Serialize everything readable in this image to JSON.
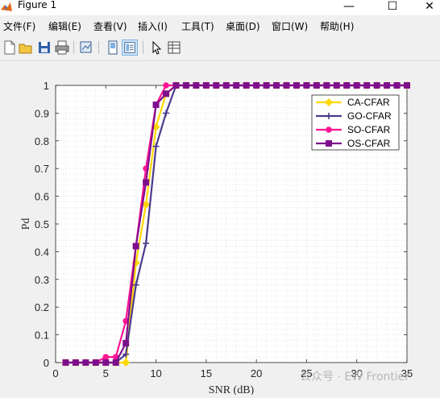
{
  "window": {
    "title": "Figure 1",
    "minimize": "—",
    "maximize": "☐",
    "close": "✕"
  },
  "menu": [
    {
      "label": "文件(F)"
    },
    {
      "label": "编辑(E)"
    },
    {
      "label": "查看(V)"
    },
    {
      "label": "插入(I)"
    },
    {
      "label": "工具(T)"
    },
    {
      "label": "桌面(D)"
    },
    {
      "label": "窗口(W)"
    },
    {
      "label": "帮助(H)"
    }
  ],
  "toolbar": [
    "new-figure-icon",
    "open-icon",
    "save-icon",
    "print-icon",
    "link-plot-icon",
    "hide-plot-tools-icon",
    "show-plot-tools-icon",
    "select-arrow-icon",
    "property-inspector-icon"
  ],
  "watermark": "公众号 · EW Frontier",
  "chart_data": {
    "type": "line",
    "xlabel": "SNR (dB)",
    "ylabel": "Pd",
    "xlim": [
      0,
      35
    ],
    "ylim": [
      0,
      1
    ],
    "xticks": [
      "0",
      "5",
      "10",
      "15",
      "20",
      "25",
      "30",
      "35"
    ],
    "yticks": [
      "0",
      "0.1",
      "0.2",
      "0.3",
      "0.4",
      "0.5",
      "0.6",
      "0.7",
      "0.8",
      "0.9",
      "1"
    ],
    "grid": "minor dotted",
    "legend_position": "top-right",
    "x": [
      1,
      2,
      3,
      4,
      5,
      6,
      7,
      8,
      9,
      10,
      11,
      12,
      13,
      14,
      15,
      16,
      17,
      18,
      19,
      20,
      21,
      22,
      23,
      24,
      25,
      26,
      27,
      28,
      29,
      30,
      31,
      32,
      33,
      34,
      35
    ],
    "series": [
      {
        "name": "CA-CFAR",
        "color": "#ffd700",
        "marker": "diamond",
        "values": [
          0,
          0,
          0,
          0,
          0,
          0,
          0,
          0.36,
          0.57,
          0.85,
          0.97,
          1,
          1,
          1,
          1,
          1,
          1,
          1,
          1,
          1,
          1,
          1,
          1,
          1,
          1,
          1,
          1,
          1,
          1,
          1,
          1,
          1,
          1,
          1,
          1
        ]
      },
      {
        "name": "GO-CFAR",
        "color": "#4b3a8c",
        "marker": "plus",
        "values": [
          0,
          0,
          0,
          0,
          0,
          0,
          0.03,
          0.28,
          0.43,
          0.78,
          0.9,
          1,
          1,
          1,
          1,
          1,
          1,
          1,
          1,
          1,
          1,
          1,
          1,
          1,
          1,
          1,
          1,
          1,
          1,
          1,
          1,
          1,
          1,
          1,
          1
        ]
      },
      {
        "name": "SO-CFAR",
        "color": "#ff1493",
        "marker": "circle",
        "values": [
          0,
          0,
          0,
          0,
          0.02,
          0.02,
          0.15,
          0.42,
          0.7,
          0.93,
          1,
          1,
          1,
          1,
          1,
          1,
          1,
          1,
          1,
          1,
          1,
          1,
          1,
          1,
          1,
          1,
          1,
          1,
          1,
          1,
          1,
          1,
          1,
          1,
          1
        ]
      },
      {
        "name": "OS-CFAR",
        "color": "#7e0f8c",
        "marker": "square",
        "values": [
          0,
          0,
          0,
          0,
          0,
          0,
          0.07,
          0.42,
          0.65,
          0.93,
          0.97,
          1,
          1,
          1,
          1,
          1,
          1,
          1,
          1,
          1,
          1,
          1,
          1,
          1,
          1,
          1,
          1,
          1,
          1,
          1,
          1,
          1,
          1,
          1,
          1
        ]
      }
    ]
  }
}
